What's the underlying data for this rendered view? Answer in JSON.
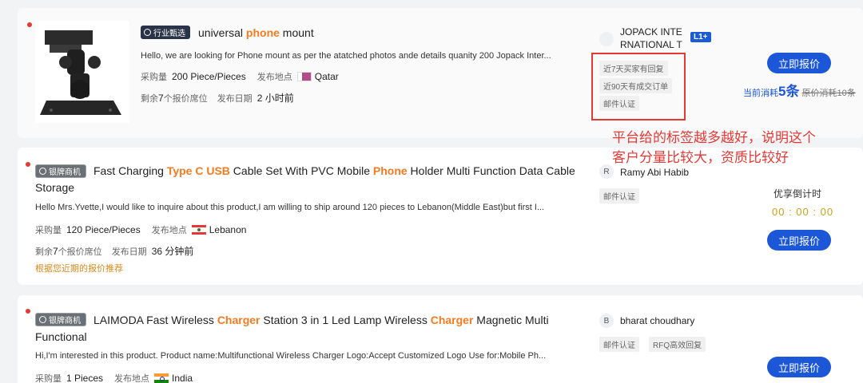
{
  "listings": [
    {
      "badge": "行业甄选",
      "title_parts": [
        {
          "text": "universal ",
          "hl": false
        },
        {
          "text": "phone",
          "hl": true
        },
        {
          "text": " mount",
          "hl": false
        }
      ],
      "description": "Hello, we are looking for Phone mount as per the atatched photos ande details quanity 200 Jopack Inter...",
      "qty_label": "采购量",
      "qty": "200 Piece/Pieces",
      "location_label": "发布地点",
      "location": "Qatar",
      "remaining_prefix": "剩余",
      "remaining_count": "7",
      "remaining_suffix": "个报价席位",
      "date_label": "发布日期",
      "date": "2 小时前",
      "buyer_name_line1": "JOPACK INTE",
      "buyer_name_line2": "RNATIONAL T",
      "buyer_level": "L1+",
      "tags": [
        "近7天买家有回复",
        "近90天有成交订单",
        "邮件认证"
      ],
      "button": "立即报价",
      "cost_label": "当前消耗",
      "cost_value": "5条",
      "cost_original": "原价消耗10条"
    },
    {
      "badge": "银牌商机",
      "title_parts": [
        {
          "text": "Fast Charging ",
          "hl": false
        },
        {
          "text": "Type C USB",
          "hl": true
        },
        {
          "text": " Cable Set With PVC Mobile ",
          "hl": false
        },
        {
          "text": "Phone",
          "hl": true
        },
        {
          "text": " Holder Multi Function Data Cable Storage",
          "hl": false
        }
      ],
      "description": "Hello Mrs.Yvette,I would like to inquire about this product,I am willing to ship around 120 pieces to Lebanon(Middle East)but first I...",
      "qty_label": "采购量",
      "qty": "120 Piece/Pieces",
      "location_label": "发布地点",
      "location": "Lebanon",
      "remaining_prefix": "剩余",
      "remaining_count": "7",
      "remaining_suffix": "个报价席位",
      "date_label": "发布日期",
      "date": "36 分钟前",
      "recommend": "根据您近期的报价推荐",
      "buyer_initial": "R",
      "buyer_name": "Ramy Abi Habib",
      "tags": [
        "邮件认证"
      ],
      "countdown_label": "优享倒计时",
      "countdown": "00 : 00 : 00",
      "button": "立即报价"
    },
    {
      "badge": "银牌商机",
      "title_parts": [
        {
          "text": "LAIMODA Fast Wireless ",
          "hl": false
        },
        {
          "text": "Charger",
          "hl": true
        },
        {
          "text": " Station 3 in 1 Led Lamp Wireless ",
          "hl": false
        },
        {
          "text": "Charger",
          "hl": true
        },
        {
          "text": " Magnetic Multi Functional",
          "hl": false
        }
      ],
      "description": "Hi,I'm interested in this product. Product name:Multifunctional Wireless Charger Logo:Accept Customized Logo Use for:Mobile Ph...",
      "qty_label": "采购量",
      "qty": "1 Pieces",
      "location_label": "发布地点",
      "location": "India",
      "buyer_initial": "B",
      "buyer_name": "bharat choudhary",
      "tags": [
        "邮件认证",
        "RFQ高效回复"
      ],
      "button": "立即报价"
    }
  ],
  "annotation_line1": "平台给的标签越多越好，说明这个",
  "annotation_line2": "客户分量比较大，资质比较好"
}
